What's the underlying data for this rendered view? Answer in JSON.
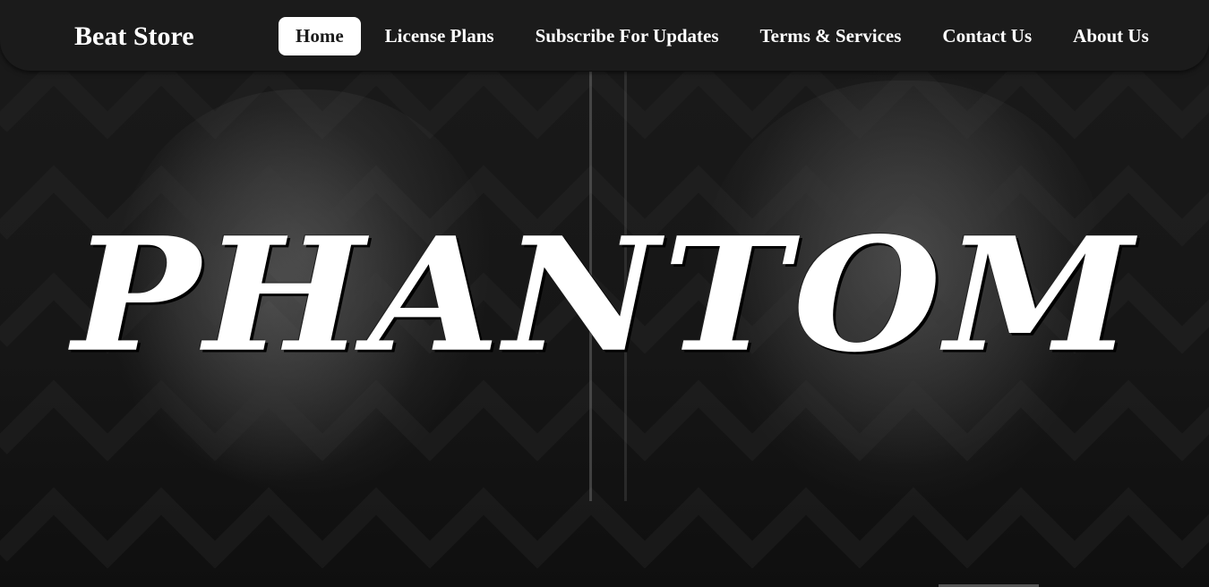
{
  "brand": "Beat Store",
  "nav": {
    "items": [
      {
        "label": "Home",
        "active": true
      },
      {
        "label": "License Plans",
        "active": false
      },
      {
        "label": "Subscribe For Updates",
        "active": false
      },
      {
        "label": "Terms & Services",
        "active": false
      },
      {
        "label": "Contact Us",
        "active": false
      },
      {
        "label": "About Us",
        "active": false
      }
    ]
  },
  "hero": {
    "title": "PHANTOM"
  },
  "colors": {
    "navbar_bg": "#1b1b1b",
    "active_tab_bg": "#ffffff",
    "text": "#ffffff",
    "page_bg": "#101010"
  }
}
